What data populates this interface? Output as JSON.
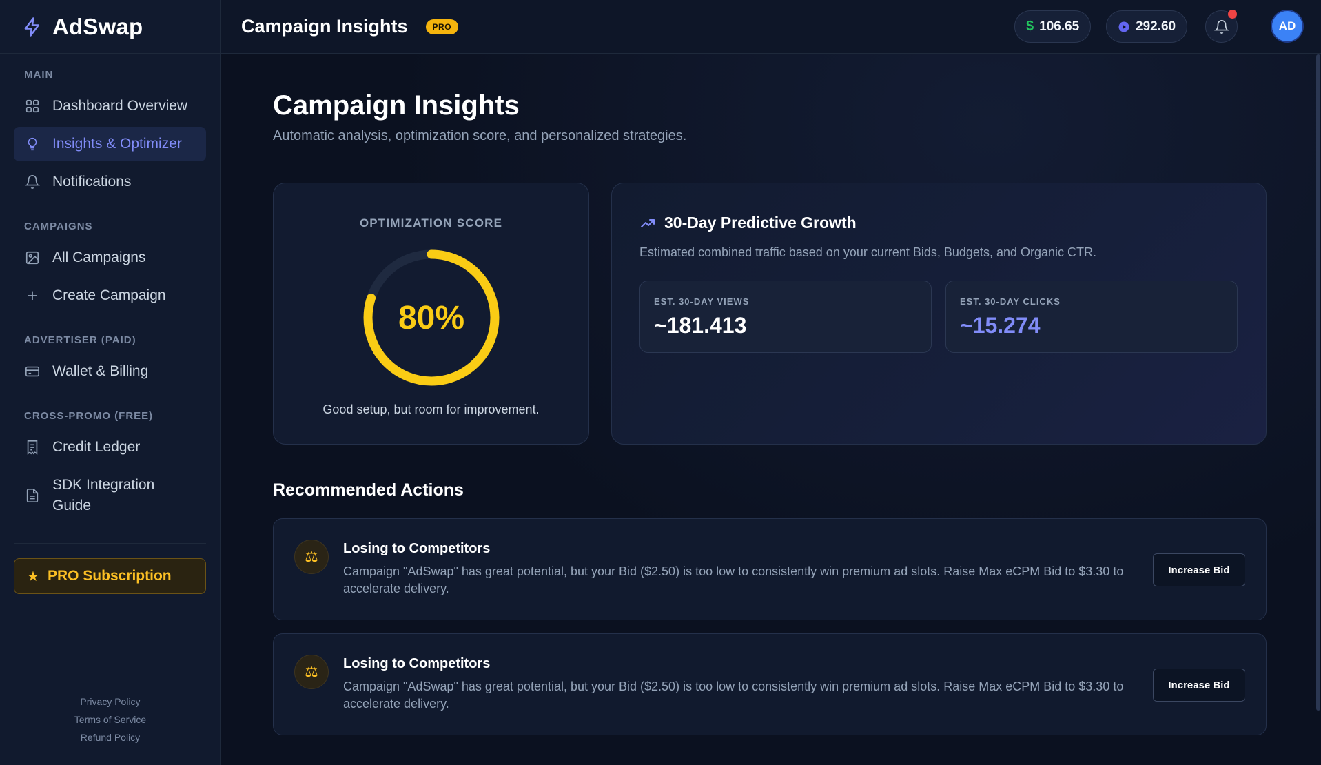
{
  "brand": {
    "name": "AdSwap"
  },
  "sidebar": {
    "sections": {
      "main": "MAIN",
      "campaigns": "CAMPAIGNS",
      "advertiser": "ADVERTISER (PAID)",
      "crosspromo": "CROSS-PROMO (FREE)"
    },
    "items": {
      "dashboard": "Dashboard Overview",
      "insights": "Insights & Optimizer",
      "notifications": "Notifications",
      "all_campaigns": "All Campaigns",
      "create_campaign": "Create Campaign",
      "wallet": "Wallet & Billing",
      "credit_ledger": "Credit Ledger",
      "sdk_guide": "SDK Integration Guide"
    },
    "pro_subscription": "PRO Subscription",
    "footer": {
      "privacy": "Privacy Policy",
      "terms": "Terms of Service",
      "refund": "Refund Policy"
    }
  },
  "header": {
    "title": "Campaign Insights",
    "badge": "PRO",
    "balance_dollar": "106.65",
    "balance_credits": "292.60",
    "avatar_initials": "AD"
  },
  "page": {
    "title": "Campaign Insights",
    "subtitle": "Automatic analysis, optimization score, and personalized strategies."
  },
  "score": {
    "label": "OPTIMIZATION SCORE",
    "value": 80,
    "display": "80%",
    "note": "Good setup, but room for improvement."
  },
  "growth": {
    "title": "30-Day Predictive Growth",
    "subtitle": "Estimated combined traffic based on your current Bids, Budgets, and Organic CTR.",
    "views_label": "EST. 30-DAY VIEWS",
    "views_value": "~181.413",
    "clicks_label": "EST. 30-DAY CLICKS",
    "clicks_value": "~15.274"
  },
  "recommended": {
    "title": "Recommended Actions",
    "actions": [
      {
        "title": "Losing to Competitors",
        "body": "Campaign \"AdSwap\" has great potential, but your Bid ($2.50) is too low to consistently win premium ad slots. Raise Max eCPM Bid to $3.30 to accelerate delivery.",
        "button": "Increase Bid",
        "icon": "scale-icon"
      },
      {
        "title": "Losing to Competitors",
        "body": "Campaign \"AdSwap\" has great potential, but your Bid ($2.50) is too low to consistently win premium ad slots. Raise Max eCPM Bid to $3.30 to accelerate delivery.",
        "button": "Increase Bid",
        "icon": "scale-icon"
      }
    ]
  },
  "colors": {
    "accent": "#818cf8",
    "gauge": "#facc15",
    "pro": "#fbbf24",
    "money": "#22c55e",
    "credits": "#6366f1",
    "alert": "#ef4444"
  }
}
